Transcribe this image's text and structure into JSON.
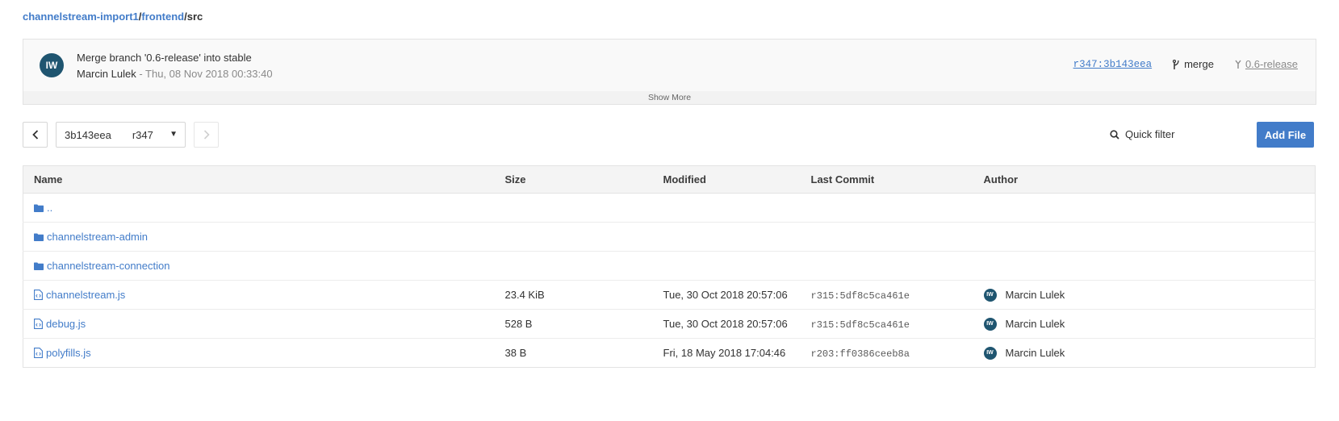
{
  "breadcrumb": {
    "repo": "channelstream-import1",
    "sep1": "/",
    "folder": "frontend",
    "sep2": "/",
    "current": "src"
  },
  "commit": {
    "avatar_initials": "IW",
    "message": "Merge branch '0.6-release' into stable",
    "author": "Marcin Lulek",
    "date": " - Thu, 08 Nov 2018 00:33:40",
    "hash": "r347:3b143eea",
    "merge_label": "merge",
    "branch_label": "0.6-release",
    "show_more": "Show More"
  },
  "toolbar": {
    "commit_hash": "3b143eea",
    "commit_rev": "r347",
    "quick_filter": "Quick filter",
    "add_file": "Add File"
  },
  "table": {
    "headers": {
      "name": "Name",
      "size": "Size",
      "modified": "Modified",
      "last_commit": "Last Commit",
      "author": "Author"
    },
    "rows": [
      {
        "type": "folder",
        "name": "..",
        "size": "",
        "modified": "",
        "commit": "",
        "author": "",
        "initials": ""
      },
      {
        "type": "folder",
        "name": "channelstream-admin",
        "size": "",
        "modified": "",
        "commit": "",
        "author": "",
        "initials": ""
      },
      {
        "type": "folder",
        "name": "channelstream-connection",
        "size": "",
        "modified": "",
        "commit": "",
        "author": "",
        "initials": ""
      },
      {
        "type": "file",
        "name": "channelstream.js",
        "size": "23.4 KiB",
        "modified": "Tue, 30 Oct 2018 20:57:06",
        "commit": "r315:5df8c5ca461e",
        "author": "Marcin Lulek",
        "initials": "IW"
      },
      {
        "type": "file",
        "name": "debug.js",
        "size": "528 B",
        "modified": "Tue, 30 Oct 2018 20:57:06",
        "commit": "r315:5df8c5ca461e",
        "author": "Marcin Lulek",
        "initials": "IW"
      },
      {
        "type": "file",
        "name": "polyfills.js",
        "size": "38 B",
        "modified": "Fri, 18 May 2018 17:04:46",
        "commit": "r203:ff0386ceeb8a",
        "author": "Marcin Lulek",
        "initials": "IW"
      }
    ]
  },
  "colors": {
    "accent": "#427cc9",
    "avatar": "#1f5570"
  }
}
